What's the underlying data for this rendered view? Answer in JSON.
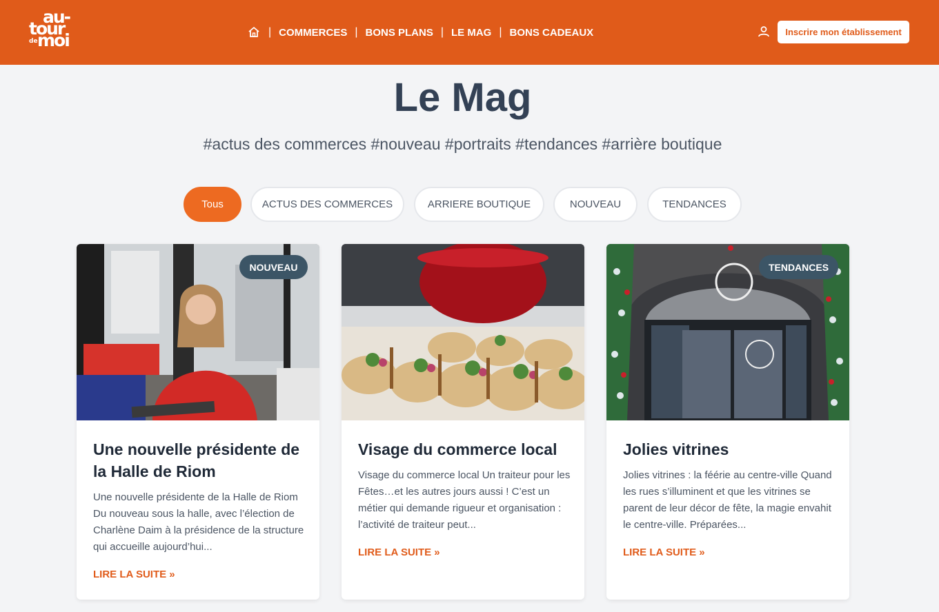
{
  "brand": {
    "logo_line1": "au-",
    "logo_line2": "tour",
    "logo_line3": "de",
    "logo_line4": "moi",
    "accent": "#e05b1a",
    "badge_color": "#3c5566"
  },
  "nav": {
    "home_icon": "home-icon",
    "items": [
      {
        "label": "COMMERCES"
      },
      {
        "label": "BONS PLANS"
      },
      {
        "label": "LE MAG"
      },
      {
        "label": "BONS CADEAUX"
      }
    ],
    "separator": "|"
  },
  "header_right": {
    "user_icon": "user-icon",
    "cta_label": "Inscrire mon établissement"
  },
  "page": {
    "title": "Le Mag",
    "subtitle": "#actus des commerces #nouveau #portraits #tendances #arrière boutique"
  },
  "filters": [
    {
      "label": "Tous",
      "active": true
    },
    {
      "label": "ACTUS DES COMMERCES",
      "active": false
    },
    {
      "label": "ARRIERE BOUTIQUE",
      "active": false
    },
    {
      "label": "NOUVEAU",
      "active": false
    },
    {
      "label": "TENDANCES",
      "active": false
    }
  ],
  "articles": [
    {
      "badge": "NOUVEAU",
      "title": "Une nouvelle présidente de la Halle de Riom",
      "excerpt": "Une nouvelle présidente de la Halle de Riom Du nouveau sous la halle, avec l’élection de Charlène Daim à la présidence de la structure qui accueille aujourd’hui...",
      "read_more": "LIRE LA SUITE »"
    },
    {
      "badge": "",
      "title": "Visage du commerce local",
      "excerpt": "Visage du commerce local  Un traiteur pour les Fêtes…et les autres jours aussi ! C’est un métier qui demande rigueur et organisation : l’activité de traiteur peut...",
      "read_more": "LIRE LA SUITE »"
    },
    {
      "badge": "TENDANCES",
      "title": "Jolies vitrines",
      "excerpt": "Jolies vitrines : la féérie au centre-ville Quand les rues s’illuminent et que les vitrines se parent de leur décor de fête, la magie envahit le centre-ville. Préparées...",
      "read_more": "LIRE LA SUITE »"
    }
  ]
}
